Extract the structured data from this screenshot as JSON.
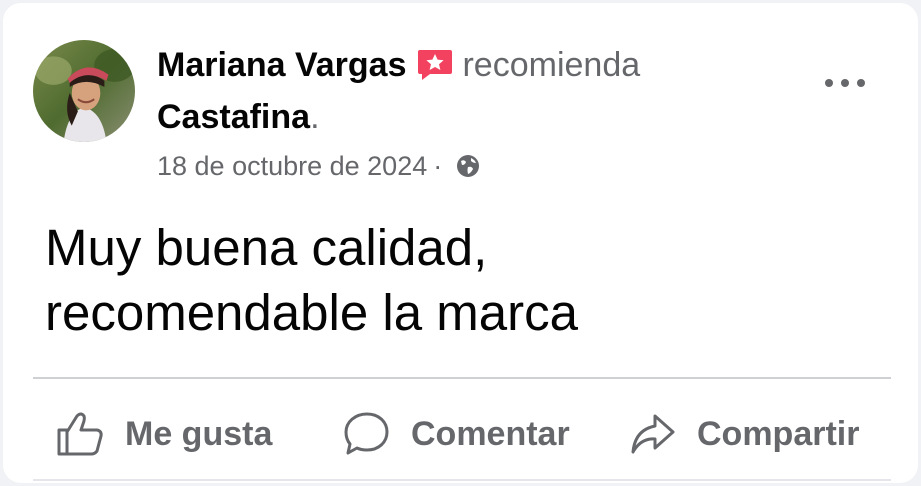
{
  "post": {
    "author": "Mariana Vargas",
    "action_text": "recomienda",
    "page_name": "Castafina",
    "period": ".",
    "date": "18 de octubre de 2024",
    "separator": "·",
    "text_line1": "Muy buena calidad,",
    "text_line2": "recomendable la marca"
  },
  "actions": {
    "like_label": "Me gusta",
    "comment_label": "Comentar",
    "share_label": "Compartir"
  },
  "icons": {
    "recommend": "recommend-star-icon",
    "privacy": "globe-icon",
    "more": "more-options-icon",
    "like": "thumbs-up-icon",
    "comment": "comment-bubble-icon",
    "share": "share-arrow-icon"
  },
  "colors": {
    "recommend_badge": "#f3425f",
    "secondary_text": "#65676b",
    "primary_text": "#050505"
  }
}
